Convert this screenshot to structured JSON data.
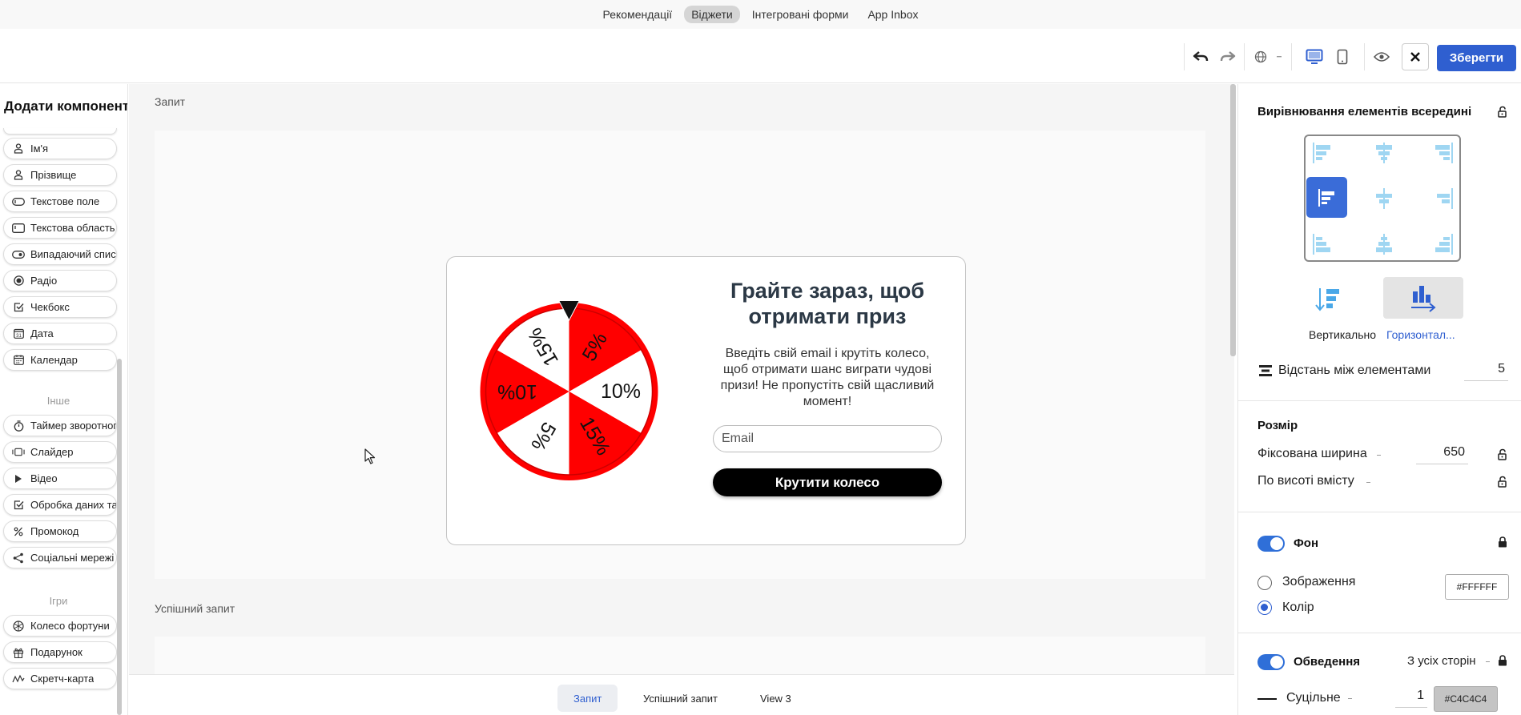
{
  "top_nav": {
    "items": [
      {
        "label": "Рекомендації",
        "active": false
      },
      {
        "label": "Віджети",
        "active": true
      },
      {
        "label": "Інтегровані форми",
        "active": false
      },
      {
        "label": "App Inbox",
        "active": false
      }
    ]
  },
  "toolbar": {
    "save_label": "Зберегти",
    "icons": [
      "undo-icon",
      "redo-icon",
      "globe-icon",
      "chevron-down-icon",
      "desktop-icon",
      "mobile-icon",
      "eye-icon",
      "close-icon"
    ]
  },
  "left_panel": {
    "title": "Додати компонент",
    "form_items": [
      {
        "label": "Ім'я",
        "icon": "person-icon"
      },
      {
        "label": "Прізвище",
        "icon": "person-icon"
      },
      {
        "label": "Текстове поле",
        "icon": "text-field-icon"
      },
      {
        "label": "Текстова область",
        "icon": "text-area-icon"
      },
      {
        "label": "Випадаючий список",
        "icon": "dropdown-icon"
      },
      {
        "label": "Радіо",
        "icon": "radio-icon"
      },
      {
        "label": "Чекбокс",
        "icon": "checkbox-icon"
      },
      {
        "label": "Дата",
        "icon": "date-icon"
      },
      {
        "label": "Календар",
        "icon": "calendar-icon"
      }
    ],
    "other_label": "Інше",
    "other_items": [
      {
        "label": "Таймер зворотного відліку",
        "icon": "timer-icon"
      },
      {
        "label": "Слайдер",
        "icon": "slider-icon"
      },
      {
        "label": "Відео",
        "icon": "play-icon"
      },
      {
        "label": "Обробка даних та згода",
        "icon": "checkbox-icon"
      },
      {
        "label": "Промокод",
        "icon": "percent-icon"
      },
      {
        "label": "Соціальні мережі",
        "icon": "share-icon"
      }
    ],
    "games_label": "Ігри",
    "game_items": [
      {
        "label": "Колесо фортуни",
        "icon": "wheel-icon"
      },
      {
        "label": "Подарунок",
        "icon": "gift-icon"
      },
      {
        "label": "Скретч-карта",
        "icon": "scratch-icon"
      }
    ]
  },
  "canvas": {
    "section1_label": "Запит",
    "section2_label": "Успішний запит",
    "widget": {
      "title": "Грайте зараз, щоб отримати приз",
      "description": "Введіть свій email і крутіть колесо, щоб отримати шанс виграти чудові призи! Не пропустіть свій щасливий момент!",
      "email_placeholder": "Email",
      "button_label": "Крутити колесо",
      "wheel_segments": [
        "5%",
        "10%",
        "15%",
        "5%",
        "10%",
        "15%"
      ],
      "wheel_colors": {
        "red": "#ff0000",
        "white": "#ffffff"
      }
    }
  },
  "bottom_tabs": [
    {
      "label": "Запит",
      "active": true
    },
    {
      "label": "Успішний запит",
      "active": false
    },
    {
      "label": "View 3",
      "active": false
    }
  ],
  "right_panel": {
    "alignment_title": "Вирівнювання елементів всередині",
    "vertical_label": "Вертикально",
    "horizontal_label": "Горизонтал...",
    "spacing_label": "Відстань між елементами",
    "spacing_value": "5",
    "size_title": "Розмір",
    "fixed_width_label": "Фіксована ширина",
    "fixed_width_value": "650",
    "content_height_label": "По висоті вмісту",
    "background_title": "Фон",
    "image_label": "Зображення",
    "color_label": "Колір",
    "background_color": "#FFFFFF",
    "border_title": "Обведення",
    "border_sides": "З усіх сторін",
    "border_style": "Суцільне",
    "border_width": "1",
    "border_color": "#C4C4C4"
  },
  "colors": {
    "accent": "#2f5fd0",
    "toggle_on": "#2f6fd8"
  }
}
